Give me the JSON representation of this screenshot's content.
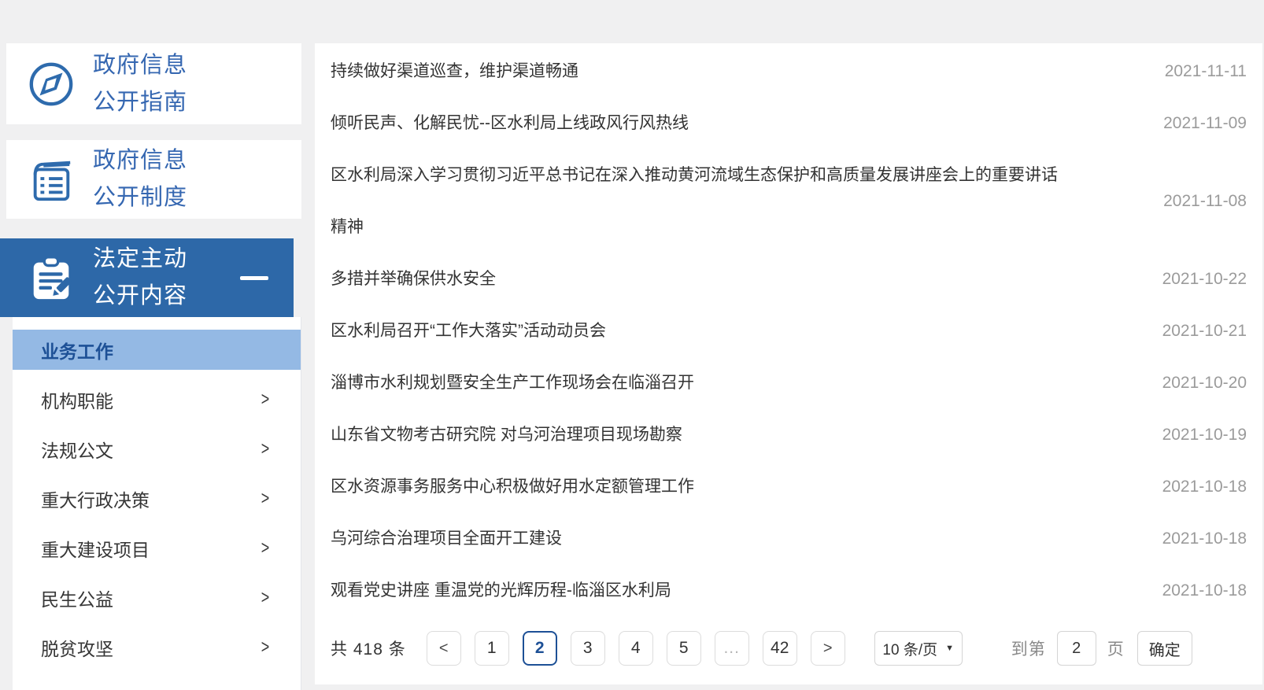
{
  "colors": {
    "page_bg": "#f0f0f1",
    "accent_blue": "#2d68a8",
    "link_blue": "#3567b1",
    "highlight_blue": "#94b9e4",
    "active_text_blue": "#1d5096",
    "title_gray": "#333333",
    "date_gray": "#9b9b9b"
  },
  "sidebar": {
    "top_items": [
      {
        "line1": "政府信息",
        "line2": "公开指南",
        "icon": "compass-icon"
      },
      {
        "line1": "政府信息",
        "line2": "公开制度",
        "icon": "book-icon"
      },
      {
        "line1": "法定主动",
        "line2": "公开内容",
        "icon": "clipboard-pencil-icon",
        "collapse_glyph": "—",
        "active": true
      }
    ],
    "sub_items": [
      {
        "label": "业务工作",
        "active": true
      },
      {
        "label": "机构职能"
      },
      {
        "label": "法规公文"
      },
      {
        "label": "重大行政决策"
      },
      {
        "label": "重大建设项目"
      },
      {
        "label": "民生公益"
      },
      {
        "label": "脱贫攻坚"
      }
    ],
    "chevron": ">"
  },
  "news": {
    "items": [
      {
        "title": "持续做好渠道巡查，维护渠道畅通",
        "date": "2021-11-11"
      },
      {
        "title": "倾听民声、化解民忧--区水利局上线政风行风热线",
        "date": "2021-11-09"
      },
      {
        "title": "区水利局深入学习贯彻习近平总书记在深入推动黄河流域生态保护和高质量发展讲座会上的重要讲话精神",
        "date": "2021-11-08"
      },
      {
        "title": "多措并举确保供水安全",
        "date": "2021-10-22"
      },
      {
        "title": "区水利局召开“工作大落实”活动动员会",
        "date": "2021-10-21"
      },
      {
        "title": "淄博市水利规划暨安全生产工作现场会在临淄召开",
        "date": "2021-10-20"
      },
      {
        "title": "山东省文物考古研究院 对乌河治理项目现场勘察",
        "date": "2021-10-19"
      },
      {
        "title": "区水资源事务服务中心积极做好用水定额管理工作",
        "date": "2021-10-18"
      },
      {
        "title": "乌河综合治理项目全面开工建设",
        "date": "2021-10-18"
      },
      {
        "title": "观看党史讲座 重温党的光辉历程-临淄区水利局",
        "date": "2021-10-18"
      }
    ]
  },
  "pagination": {
    "total_text": "共 418 条",
    "prev": "<",
    "next": ">",
    "pages": [
      "1",
      "2",
      "3",
      "4",
      "5",
      "...",
      "42"
    ],
    "active_page": "2",
    "page_size": "10 条/页",
    "caret": "▼",
    "goto_prefix": "到第",
    "goto_value": "2",
    "goto_suffix": "页",
    "confirm_label": "确定"
  }
}
